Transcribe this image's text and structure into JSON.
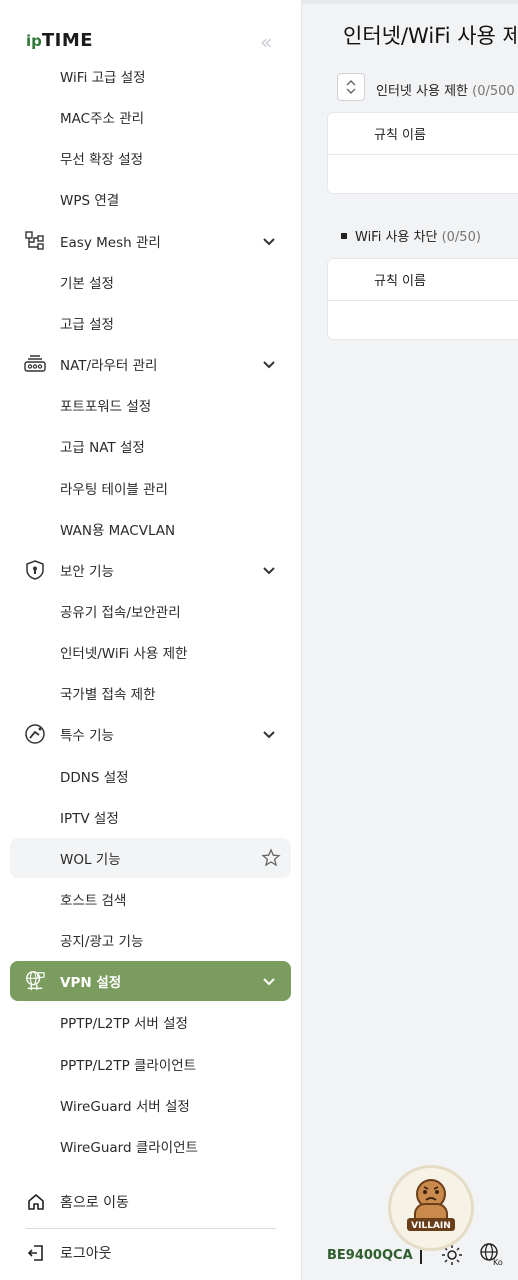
{
  "app": {
    "logo_prefix": "ip",
    "logo_main": "TIME",
    "collapse_glyph": "«"
  },
  "sidebar": {
    "items": [
      {
        "label": "WiFi 고급 설정",
        "type": "sub"
      },
      {
        "label": "MAC주소 관리",
        "type": "sub"
      },
      {
        "label": "무선 확장 설정",
        "type": "sub"
      },
      {
        "label": "WPS 연결",
        "type": "sub"
      },
      {
        "label": "Easy Mesh 관리",
        "type": "group",
        "icon": "mesh-icon"
      },
      {
        "label": "기본 설정",
        "type": "sub"
      },
      {
        "label": "고급 설정",
        "type": "sub"
      },
      {
        "label": "NAT/라우터 관리",
        "type": "group",
        "icon": "router-icon"
      },
      {
        "label": "포트포워드 설정",
        "type": "sub"
      },
      {
        "label": "고급 NAT 설정",
        "type": "sub"
      },
      {
        "label": "라우팅 테이블 관리",
        "type": "sub"
      },
      {
        "label": "WAN용 MACVLAN",
        "type": "sub"
      },
      {
        "label": "보안 기능",
        "type": "group",
        "icon": "shield-icon"
      },
      {
        "label": "공유기 접속/보안관리",
        "type": "sub"
      },
      {
        "label": "인터넷/WiFi 사용 제한",
        "type": "sub"
      },
      {
        "label": "국가별 접속 제한",
        "type": "sub"
      },
      {
        "label": "특수 기능",
        "type": "group",
        "icon": "special-icon"
      },
      {
        "label": "DDNS 설정",
        "type": "sub"
      },
      {
        "label": "IPTV 설정",
        "type": "sub"
      },
      {
        "label": "WOL 기능",
        "type": "sub",
        "hover": true
      },
      {
        "label": "호스트 검색",
        "type": "sub"
      },
      {
        "label": "공지/광고 기능",
        "type": "sub"
      },
      {
        "label": "VPN 설정",
        "type": "group",
        "icon": "vpn-icon",
        "active": true
      },
      {
        "label": "PPTP/L2TP 서버 설정",
        "type": "sub"
      },
      {
        "label": "PPTP/L2TP 클라이언트",
        "type": "sub"
      },
      {
        "label": "WireGuard 서버 설정",
        "type": "sub"
      },
      {
        "label": "WireGuard 클라이언트",
        "type": "sub"
      }
    ],
    "footer": {
      "home": "홈으로 이동",
      "logout": "로그아웃"
    }
  },
  "main": {
    "title": "인터넷/WiFi 사용 제",
    "internet_section": {
      "label": "인터넷 사용 제한",
      "count": "(0/500"
    },
    "wifi_section": {
      "label": "WiFi 사용 차단",
      "count": "(0/50)"
    },
    "table_header": "규칙 이름"
  },
  "footer": {
    "model": "BE9400QCA",
    "mascot_text": "VILLAIN"
  },
  "colors": {
    "accent": "#7a9c5e",
    "brand_green": "#2f7a3a"
  }
}
